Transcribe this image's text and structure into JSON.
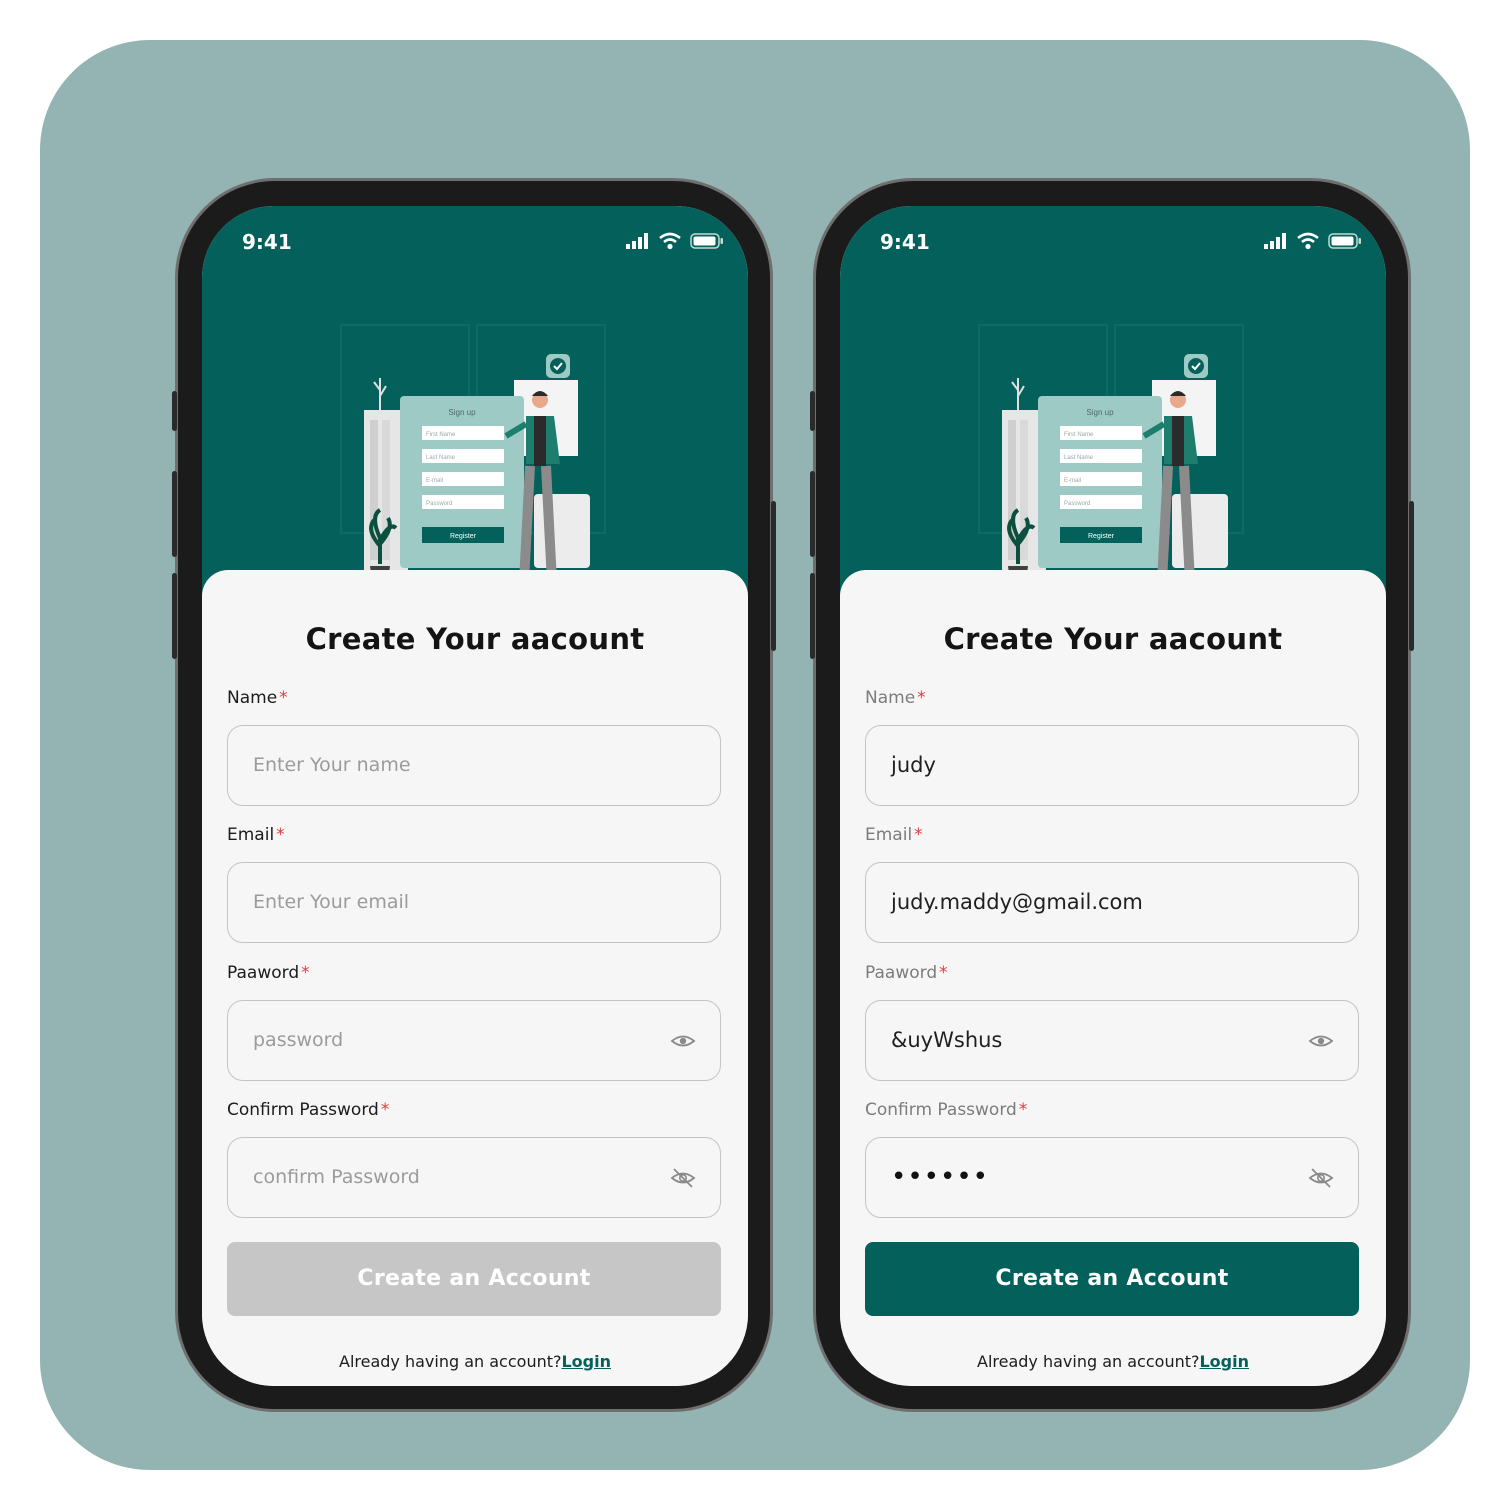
{
  "colors": {
    "background": "#94b4b3",
    "brand": "#04605b",
    "disabled": "#c6c6c6",
    "required": "#e23b3b"
  },
  "illustration": {
    "form_title": "Sign up",
    "form_fields": [
      "First Name",
      "Last Name",
      "E-mail",
      "Password"
    ],
    "form_button": "Register"
  },
  "screens": [
    {
      "state": "empty",
      "status": {
        "time": "9:41"
      },
      "title": "Create Your aacount",
      "fields": {
        "name": {
          "label": "Name",
          "placeholder": "Enter Your name",
          "value": ""
        },
        "email": {
          "label": "Email",
          "placeholder": "Enter Your email",
          "value": ""
        },
        "password": {
          "label": "Paaword",
          "placeholder": "password",
          "value": "",
          "icon": "eye-icon"
        },
        "confirm": {
          "label": "Confirm Password",
          "placeholder": "confirm Password",
          "value": "",
          "icon": "eye-off-icon"
        }
      },
      "required_mark": "*",
      "button": {
        "label": "Create an Account",
        "enabled": false
      },
      "footer": {
        "text": "Already having an account?",
        "link": "Login"
      }
    },
    {
      "state": "filled",
      "status": {
        "time": "9:41"
      },
      "title": "Create Your aacount",
      "fields": {
        "name": {
          "label": "Name",
          "placeholder": "",
          "value": "judy"
        },
        "email": {
          "label": "Email",
          "placeholder": "",
          "value": "judy.maddy@gmail.com"
        },
        "password": {
          "label": "Paaword",
          "placeholder": "",
          "value": "&uyWshus",
          "icon": "eye-icon"
        },
        "confirm": {
          "label": "Confirm Password",
          "placeholder": "",
          "value": "••••••",
          "icon": "eye-off-icon"
        }
      },
      "required_mark": "*",
      "button": {
        "label": "Create an Account",
        "enabled": true
      },
      "footer": {
        "text": "Already having an account?",
        "link": "Login"
      }
    }
  ]
}
